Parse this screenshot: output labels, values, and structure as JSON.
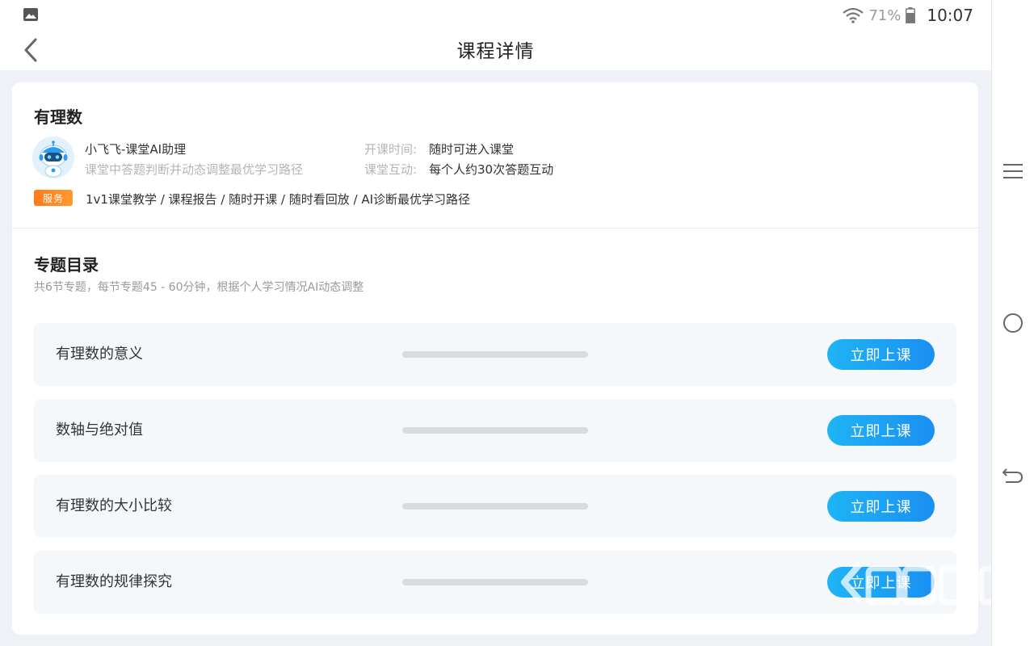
{
  "status_bar": {
    "battery_percent": "71%",
    "time": "10:07",
    "left_icon": "image-icon",
    "icons": [
      "wifi-icon",
      "battery-icon"
    ]
  },
  "header": {
    "title": "课程详情",
    "back_icon": "chevron-left-icon"
  },
  "course": {
    "name": "有理数",
    "teacher_name": "小飞飞-课堂AI助理",
    "teacher_desc": "课堂中答题判断并动态调整最优学习路径",
    "start_time_label": "开课时间:",
    "start_time_value": "随时可进入课堂",
    "interaction_label": "课堂互动:",
    "interaction_value": "每个人约30次答题互动",
    "service_badge": "服务",
    "services": "1v1课堂教学 / 课程报告 / 随时开课 / 随时看回放 / AI诊断最优学习路径"
  },
  "catalog": {
    "title": "专题目录",
    "subtitle": "共6节专题，每节专题45 - 60分钟，根据个人学习情况AI动态调整",
    "lessons": [
      {
        "name": "有理数的意义",
        "button": "立即上课"
      },
      {
        "name": "数轴与绝对值",
        "button": "立即上课"
      },
      {
        "name": "有理数的大小比较",
        "button": "立即上课"
      },
      {
        "name": "有理数的规律探究",
        "button": "立即上课"
      }
    ]
  },
  "system_nav": [
    "menu-icon",
    "home-circle-icon",
    "back-arrow-icon"
  ],
  "colors": {
    "accent_blue": "#1a9bf3",
    "badge_orange": "#ff8a22",
    "page_bg": "#eef1f5",
    "lesson_bg": "#f5f8fb"
  }
}
